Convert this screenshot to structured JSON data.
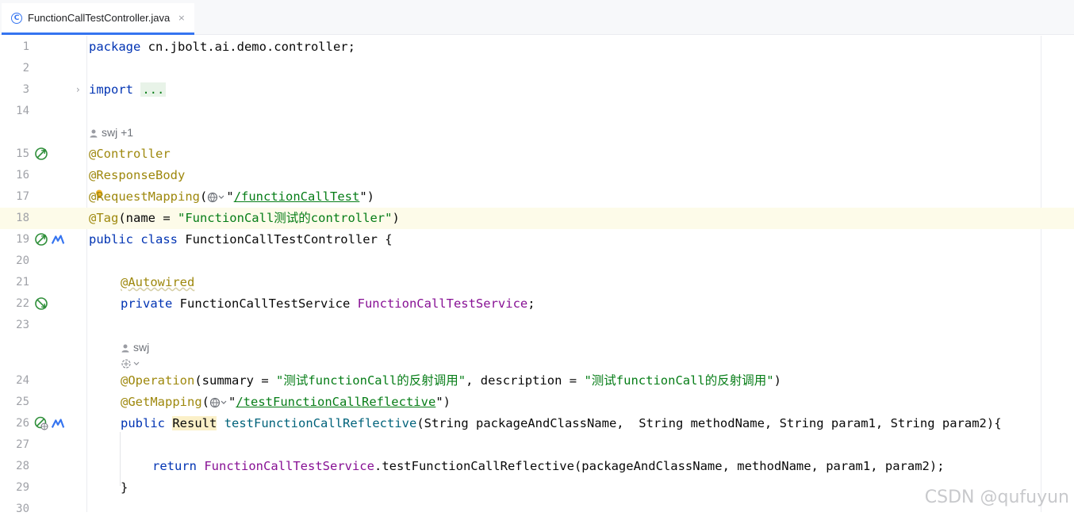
{
  "tab": {
    "icon": "class-c-icon",
    "title": "FunctionCallTestController.java",
    "close": "×"
  },
  "line_numbers": [
    "1",
    "2",
    "3",
    "14",
    "15",
    "16",
    "17",
    "18",
    "19",
    "20",
    "21",
    "22",
    "23",
    "24",
    "25",
    "26",
    "27",
    "28",
    "29",
    "30"
  ],
  "code": {
    "l1_kw": "package",
    "l1_rest": " cn.jbolt.ai.demo.controller;",
    "l3_kw": "import",
    "l3_fold": "...",
    "author1": "swj +1",
    "l15": "@Controller",
    "l16": "@ResponseBody",
    "l17_at": "@",
    "l17_ann": "RequestMapping",
    "l17_paren": "(",
    "l17_url": "/functionCallTest",
    "l17_end": ")",
    "l18_ann": "@Tag",
    "l18_mid": "(name = ",
    "l18_str": "\"FunctionCall测试的controller\"",
    "l18_end": ")",
    "l19_kw": "public class",
    "l19_rest": " FunctionCallTestController {",
    "l21": "@Autowired",
    "l22_kw": "private",
    "l22_type": " FunctionCallTestService ",
    "l22_fld": "FunctionCallTestService",
    "l22_end": ";",
    "author2": "swj",
    "l24_ann": "@Operation",
    "l24_a": "(summary = ",
    "l24_s1": "\"测试functionCall的反射调用\"",
    "l24_b": ", description = ",
    "l24_s2": "\"测试functionCall的反射调用\"",
    "l24_end": ")",
    "l25_ann": "@GetMapping",
    "l25_url": "/testFunctionCallReflective",
    "l26_kw": "public",
    "l26_res": "Result",
    "l26_mth": "testFunctionCallReflective",
    "l26_rest": "(String packageAndClassName,  String methodName, String param1, String param2){",
    "l28_kw": "return",
    "l28_fld": "FunctionCallTestService",
    "l28_rest": ".testFunctionCallReflective(packageAndClassName, methodName, param1, param2);",
    "l29": "}"
  },
  "watermark": "CSDN @qufuyun",
  "colors": {
    "keyword": "#0033b3",
    "annotation": "#9e880d",
    "string": "#067d17",
    "field": "#871094",
    "method": "#00627a",
    "accent": "#3574f0"
  }
}
